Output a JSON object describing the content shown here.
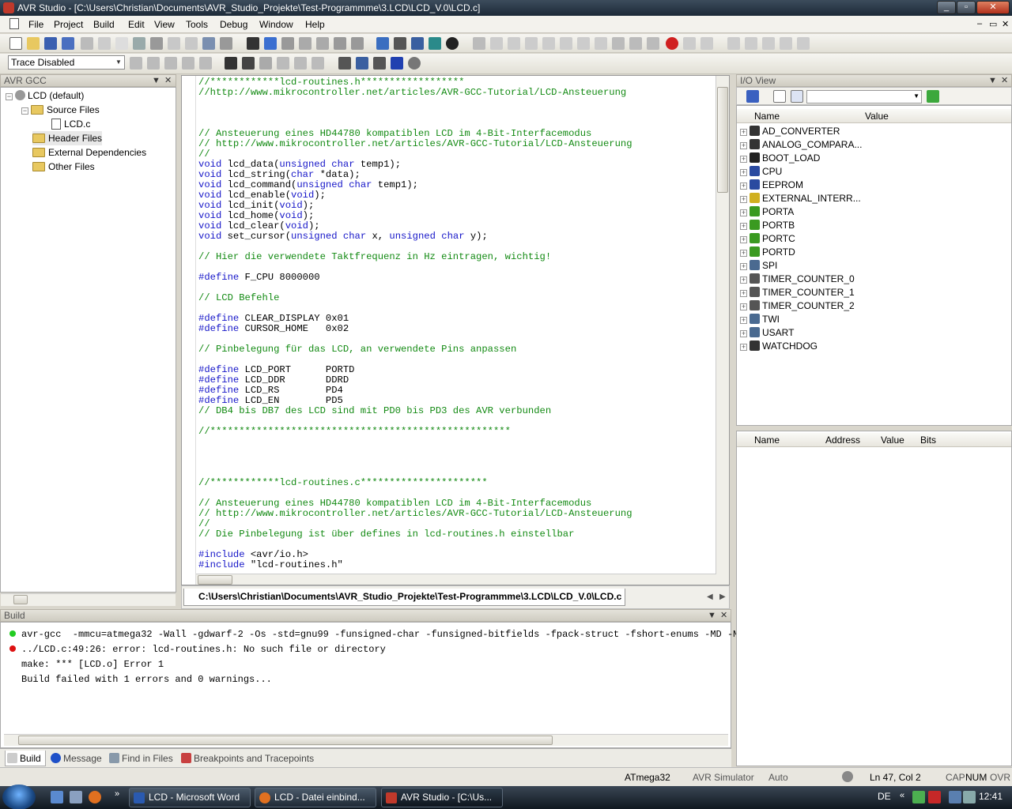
{
  "window": {
    "title": "AVR Studio - [C:\\Users\\Christian\\Documents\\AVR_Studio_Projekte\\Test-Programmme\\3.LCD\\LCD_V.0\\LCD.c]"
  },
  "menu": [
    "File",
    "Project",
    "Build",
    "Edit",
    "View",
    "Tools",
    "Debug",
    "Window",
    "Help"
  ],
  "toolbar2": {
    "trace_select": "Trace Disabled"
  },
  "project_panel": {
    "title": "AVR GCC",
    "root": "LCD (default)",
    "items": [
      "Source Files",
      "LCD.c",
      "Header Files",
      "External Dependencies",
      "Other Files"
    ]
  },
  "editor": {
    "file_tab": "C:\\Users\\Christian\\Documents\\AVR_Studio_Projekte\\Test-Programmme\\3.LCD\\LCD_V.0\\LCD.c",
    "lines": [
      "//************lcd-routines.h******************",
      "//http://www.mikrocontroller.net/articles/AVR-GCC-Tutorial/LCD-Ansteuerung",
      "",
      "",
      "",
      "// Ansteuerung eines HD44780 kompatiblen LCD im 4-Bit-Interfacemodus",
      "// http://www.mikrocontroller.net/articles/AVR-GCC-Tutorial/LCD-Ansteuerung",
      "//",
      "void lcd_data(unsigned char temp1);",
      "void lcd_string(char *data);",
      "void lcd_command(unsigned char temp1);",
      "void lcd_enable(void);",
      "void lcd_init(void);",
      "void lcd_home(void);",
      "void lcd_clear(void);",
      "void set_cursor(unsigned char x, unsigned char y);",
      "",
      "// Hier die verwendete Taktfrequenz in Hz eintragen, wichtig!",
      "",
      "#define F_CPU 8000000",
      "",
      "// LCD Befehle",
      "",
      "#define CLEAR_DISPLAY 0x01",
      "#define CURSOR_HOME   0x02",
      "",
      "// Pinbelegung für das LCD, an verwendete Pins anpassen",
      "",
      "#define LCD_PORT      PORTD",
      "#define LCD_DDR       DDRD",
      "#define LCD_RS        PD4",
      "#define LCD_EN        PD5",
      "// DB4 bis DB7 des LCD sind mit PD0 bis PD3 des AVR verbunden",
      "",
      "//****************************************************",
      "",
      "",
      "",
      "",
      "//************lcd-routines.c**********************",
      "",
      "// Ansteuerung eines HD44780 kompatiblen LCD im 4-Bit-Interfacemodus",
      "// http://www.mikrocontroller.net/articles/AVR-GCC-Tutorial/LCD-Ansteuerung",
      "//",
      "// Die Pinbelegung ist über defines in lcd-routines.h einstellbar",
      "",
      "#include <avr/io.h>",
      "#include \"lcd-routines.h\""
    ]
  },
  "build_panel": {
    "title": "Build",
    "lines": [
      {
        "status": "ok",
        "text": "avr-gcc  -mmcu=atmega32 -Wall -gdwarf-2 -Os -std=gnu99 -funsigned-char -funsigned-bitfields -fpack-struct -fshort-enums -MD -MP"
      },
      {
        "status": "error",
        "text": "../LCD.c:49:26: error: lcd-routines.h: No such file or directory"
      },
      {
        "status": "",
        "text": "make: *** [LCD.o] Error 1"
      },
      {
        "status": "",
        "text": "Build failed with 1 errors and 0 warnings..."
      }
    ],
    "tabs": [
      "Build",
      "Message",
      "Find in Files",
      "Breakpoints and Tracepoints"
    ]
  },
  "io_view": {
    "title": "I/O View",
    "columns": [
      "Name",
      "Value"
    ],
    "items": [
      "AD_CONVERTER",
      "ANALOG_COMPARA...",
      "BOOT_LOAD",
      "CPU",
      "EEPROM",
      "EXTERNAL_INTERR...",
      "PORTA",
      "PORTB",
      "PORTC",
      "PORTD",
      "SPI",
      "TIMER_COUNTER_0",
      "TIMER_COUNTER_1",
      "TIMER_COUNTER_2",
      "TWI",
      "USART",
      "WATCHDOG"
    ],
    "reg_columns": [
      "Name",
      "Address",
      "Value",
      "Bits"
    ]
  },
  "status": {
    "device": "ATmega32",
    "platform": "AVR Simulator",
    "mode": "Auto",
    "position": "Ln 47, Col 2",
    "caps": "CAP",
    "num": "NUM",
    "ovr": "OVR"
  },
  "taskbar": {
    "buttons": [
      "LCD - Microsoft Word",
      "LCD - Datei einbind...",
      "AVR Studio - [C:\\Us..."
    ],
    "lang": "DE",
    "clock": "12:41"
  },
  "colors": {
    "keyword": "#1515c8",
    "comment": "#138a13",
    "ok_dot": "#22cc22",
    "error_dot": "#dd1111"
  }
}
